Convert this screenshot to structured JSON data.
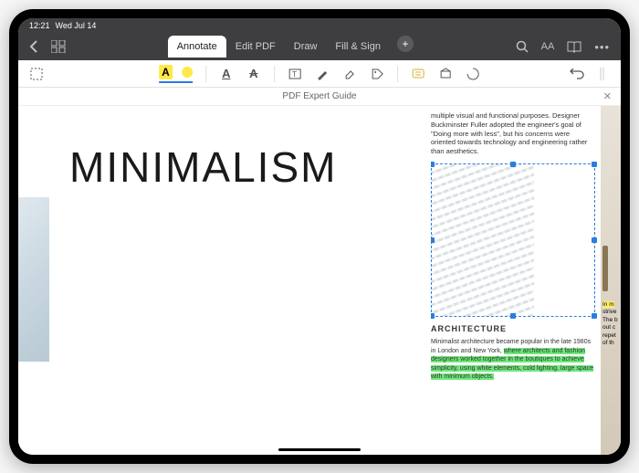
{
  "status": {
    "time": "12:21",
    "date": "Wed Jul 14"
  },
  "tabs": {
    "annotate": "Annotate",
    "editpdf": "Edit PDF",
    "draw": "Draw",
    "fillsign": "Fill & Sign"
  },
  "toolbar": {
    "highlight_letter": "A",
    "underline_letter": "A",
    "strike_letter": "A"
  },
  "doc": {
    "title": "PDF Expert Guide"
  },
  "page": {
    "big_title": "MINIMALISM",
    "top_para": "multiple visual and functional purposes. Designer Buckminster Fuller adopted the engineer's goal of \"Doing more with less\", but his concerns were oriented towards technology and engineering rather than aesthetics.",
    "arch_heading": "ARCHITECTURE",
    "arch_p1": "Minimalist architecture became popular in the late 1980s in London and New York, ",
    "arch_p2": "where architects and fashion designers worked together in the boutiques to achieve simplicity, using white elements, cold lighting, large space with minimum objects.",
    "side_yellow": "In m",
    "side_rest": "strive\nThe b\nout c\nrepet\nof th"
  }
}
